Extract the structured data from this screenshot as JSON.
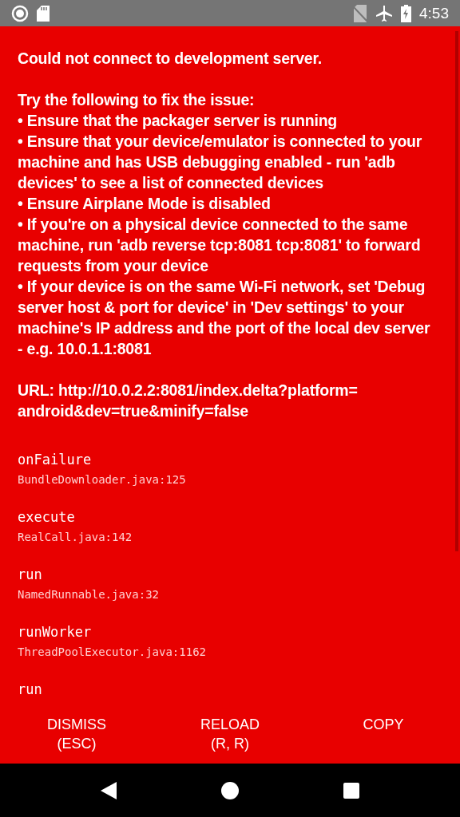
{
  "status_bar": {
    "time": "4:53"
  },
  "message": {
    "title": "Could not connect to development server.",
    "intro": "Try the following to fix the issue:",
    "tips": [
      "• Ensure that the packager server is running",
      "• Ensure that your device/emulator is connected to your machine and has USB debugging enabled - run 'adb devices' to see a list of connected devices",
      "• Ensure Airplane Mode is disabled",
      "• If you're on a physical device connected to the same machine, run 'adb reverse tcp:8081 tcp:8081' to forward requests from your device",
      "• If your device is on the same Wi-Fi network, set 'Debug server host & port for device' in 'Dev settings' to your machine's IP address and the port of the local dev server - e.g. 10.0.1.1:8081"
    ],
    "url": "URL: http://10.0.2.2:8081/index.delta?platform= android&dev=true&minify=false"
  },
  "stack": [
    {
      "method": "onFailure",
      "file": "BundleDownloader.java:125"
    },
    {
      "method": "execute",
      "file": "RealCall.java:142"
    },
    {
      "method": "run",
      "file": "NamedRunnable.java:32"
    },
    {
      "method": "runWorker",
      "file": "ThreadPoolExecutor.java:1162"
    },
    {
      "method": "run"
    }
  ],
  "buttons": [
    {
      "label": "DISMISS",
      "shortcut": "(ESC)"
    },
    {
      "label": "RELOAD",
      "shortcut": "(R, R)"
    },
    {
      "label": "COPY"
    }
  ]
}
